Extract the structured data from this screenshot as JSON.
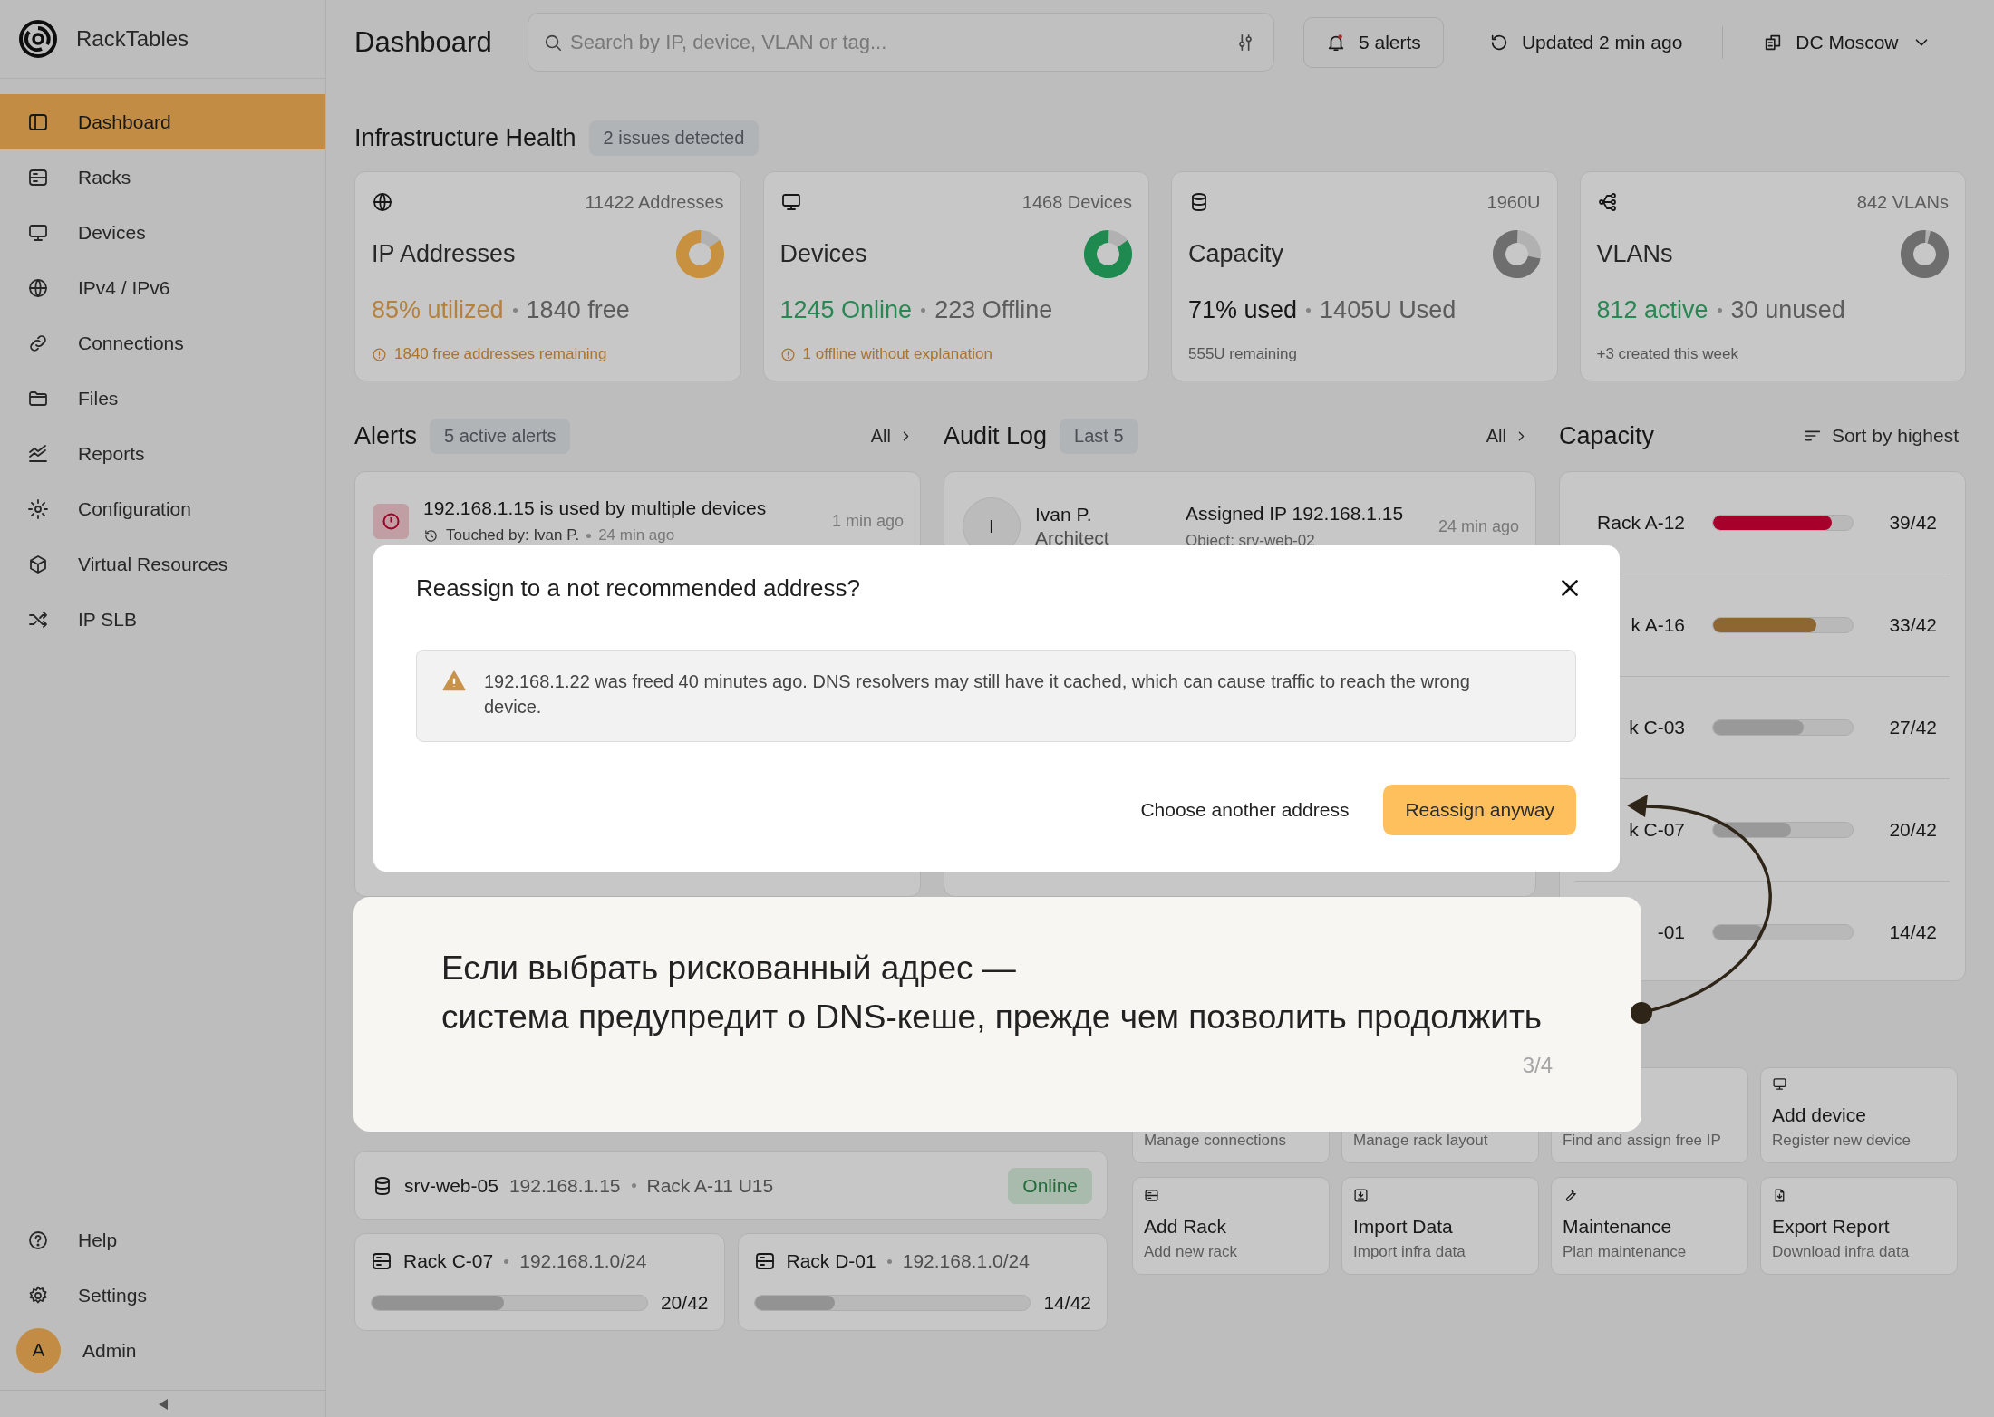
{
  "app": {
    "name": "RackTables"
  },
  "sidebar": {
    "items": [
      {
        "label": "Dashboard",
        "selected": true
      },
      {
        "label": "Racks",
        "selected": false
      },
      {
        "label": "Devices",
        "selected": false
      },
      {
        "label": "IPv4 / IPv6",
        "selected": false
      },
      {
        "label": "Connections",
        "selected": false
      },
      {
        "label": "Files",
        "selected": false
      },
      {
        "label": "Reports",
        "selected": false
      },
      {
        "label": "Configuration",
        "selected": false
      },
      {
        "label": "Virtual Resources",
        "selected": false
      },
      {
        "label": "IP SLB",
        "selected": false
      }
    ],
    "footer_items": [
      {
        "label": "Help",
        "selected": false
      },
      {
        "label": "Settings",
        "selected": false
      }
    ],
    "user": {
      "initial": "A",
      "name": "Admin"
    }
  },
  "header": {
    "title": "Dashboard",
    "search": {
      "placeholder": "Search by IP, device, VLAN or tag..."
    },
    "alerts_button": "5 alerts",
    "updated": "Updated 2 min ago",
    "datacenter": "DC Moscow"
  },
  "health": {
    "title": "Infrastructure Health",
    "badge": "2 issues detected",
    "cards": [
      {
        "count": "11422 Addresses",
        "title": "IP Addresses",
        "kind": "accent",
        "primary": "85% utilized",
        "secondary": "1840 free",
        "note": "1840 free addresses remaining",
        "warning": true,
        "level": 0.85,
        "color": "#c8913f"
      },
      {
        "count": "1468 Devices",
        "title": "Devices",
        "kind": "positive",
        "primary": "1245 Online",
        "secondary": "223 Offline",
        "note": "1 offline without explanation",
        "warning": true,
        "level": 0.85,
        "color": "#1f8a50"
      },
      {
        "count": "1960U",
        "title": "Capacity",
        "kind": "plain",
        "primary": "71% used",
        "secondary": "1405U Used",
        "note": "555U remaining",
        "warning": false,
        "level": 0.72,
        "color": "#6e6e6e"
      },
      {
        "count": "842 VLANs",
        "title": "VLANs",
        "kind": "positive",
        "primary": "812 active",
        "secondary": "30 unused",
        "note": "+3 created this week",
        "warning": false,
        "level": 0.96,
        "color": "#6e6e6e"
      }
    ]
  },
  "alerts": {
    "title": "Alerts",
    "badge": "5 active alerts",
    "link": "All",
    "items": [
      {
        "title": "192.168.1.15 is used by multiple devices",
        "touched": "Touched by: Ivan P.",
        "ago": "24 min ago",
        "time": "1 min ago"
      }
    ]
  },
  "audit_log": {
    "title": "Audit Log",
    "badge": "Last 5",
    "link": "All",
    "items": [
      {
        "initial": "I",
        "user": "Ivan P.",
        "role": "Architect",
        "action": "Assigned IP 192.168.1.15",
        "object": "Object: srv-web-02",
        "time": "24 min ago"
      }
    ]
  },
  "capacity": {
    "title": "Capacity",
    "sort": "Sort by highest",
    "racks": [
      {
        "label": "Rack A-12",
        "value": "39/42",
        "level": 0.85,
        "color": "#a8002a"
      },
      {
        "label": "k A-16",
        "value": "33/42",
        "level": 0.74,
        "color": "#8e6633"
      },
      {
        "label": "k C-03",
        "value": "27/42",
        "level": 0.65,
        "color": "#9a9a9a"
      },
      {
        "label": "k C-07",
        "value": "20/42",
        "level": 0.56,
        "color": "#9a9a9a"
      },
      {
        "label": "-01",
        "value": "14/42",
        "level": 0.36,
        "color": "#9a9a9a"
      }
    ]
  },
  "device_row": {
    "name": "srv-web-05",
    "ip": "192.168.1.15",
    "location": "Rack A-11 U15",
    "status": "Online"
  },
  "rack_cards": [
    {
      "name": "Rack C-07",
      "subnet": "192.168.1.0/24",
      "value": "20/42",
      "level": 0.48
    },
    {
      "name": "Rack D-01",
      "subnet": "192.168.1.0/24",
      "value": "14/42",
      "level": 0.29
    }
  ],
  "quick_actions": [
    {
      "subtitle": "Manage connections"
    },
    {
      "subtitle": "Manage rack layout"
    },
    {
      "subtitle": "Find and assign free IP"
    },
    {
      "title": "Add device",
      "subtitle": "Register new device"
    },
    {
      "title": "Add Rack",
      "subtitle": "Add new rack"
    },
    {
      "title": "Import Data",
      "subtitle": "Import infra data"
    },
    {
      "title": "Maintenance",
      "subtitle": "Plan maintenance"
    },
    {
      "title": "Export Report",
      "subtitle": "Download infra data"
    }
  ],
  "modal": {
    "title": "Reassign to a not recommended address?",
    "warning": "192.168.1.22 was freed 40 minutes ago. DNS resolvers may still have it cached, which can cause traffic to reach the wrong device.",
    "secondary_button": "Choose another address",
    "primary_button": "Reassign anyway"
  },
  "tour": {
    "text": "Если выбрать рискованный адрес —\nсистема предупредит о DNS-кеше, прежде чем позволить продолжить",
    "step": "3/4"
  }
}
